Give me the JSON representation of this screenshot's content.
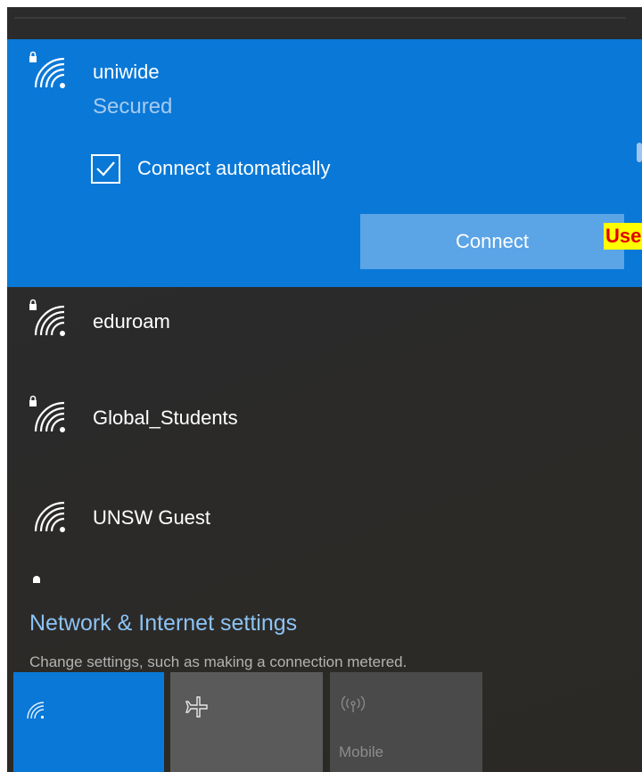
{
  "networks": {
    "selected": {
      "name": "uniwide",
      "status": "Secured",
      "connect_automatically_label": "Connect automatically",
      "connect_automatically_checked": true,
      "connect_button_label": "Connect",
      "icon": "wifi-secured-icon"
    },
    "list": [
      {
        "name": "eduroam",
        "secured": true,
        "icon": "wifi-secured-icon"
      },
      {
        "name": "Global_Students",
        "secured": true,
        "icon": "wifi-secured-icon"
      },
      {
        "name": "UNSW Guest",
        "secured": false,
        "icon": "wifi-icon"
      }
    ]
  },
  "annotation": {
    "text": "Use"
  },
  "settings": {
    "link_label": "Network & Internet settings",
    "description": "Change settings, such as making a connection metered."
  },
  "quick_actions": [
    {
      "id": "wifi",
      "label": "",
      "icon": "wifi-icon",
      "active": true
    },
    {
      "id": "airplane",
      "label": "",
      "icon": "airplane-icon",
      "active": false
    },
    {
      "id": "mobile",
      "label": "Mobile",
      "icon": "mobile-hotspot-icon",
      "active": false
    }
  ],
  "colors": {
    "accent": "#0a78d7",
    "connect_button": "#5ba4e6",
    "panel_background": "#2b2b2b",
    "link": "#8cc3f5",
    "annotation_background": "#ffff00",
    "annotation_text": "#e00000"
  }
}
